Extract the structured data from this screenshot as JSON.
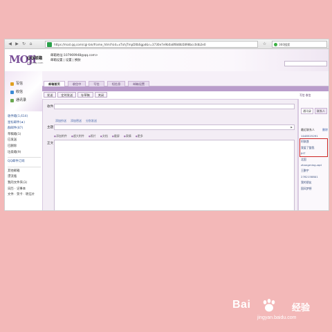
{
  "browser": {
    "url": "https://mail.qq.com/cgi-bin/frame_html?sid=xTxhjTmpD0bSgpd&r=3730e7e9b0a8f8d8b5898bcc0db2e0",
    "search_placeholder": "360搜索"
  },
  "header": {
    "logo_text": "MOJi",
    "brand": "QQ邮箱",
    "domain": "mail.qq.com",
    "account_line1": "邮箱地址:107969948@qq.com>",
    "account_line2": "邮箱设置 | 设置 | 换肤"
  },
  "tabs": [
    "邮箱首页",
    "收信中",
    "写信",
    "短信息",
    "邮箱设置"
  ],
  "left_actions": [
    {
      "label": "写信",
      "color": "#e0a020"
    },
    {
      "label": "收信",
      "color": "#3a8ad6"
    },
    {
      "label": "通讯录",
      "color": "#6aa84f"
    }
  ],
  "folders": [
    {
      "label": "收件箱(1,614)",
      "link": true
    },
    {
      "label": "星标邮件(★)",
      "link": true
    },
    {
      "label": "群邮件(87)",
      "link": true
    },
    {
      "label": "草稿箱(1)",
      "link": false
    },
    {
      "label": "已发送",
      "link": false
    },
    {
      "label": "已删除",
      "link": false
    },
    {
      "label": "垃圾箱(9)",
      "link": false
    },
    {
      "label": "QQ邮件订阅",
      "link": true
    },
    {
      "label": "其他邮箱",
      "link": false
    },
    {
      "label": "漂流瓶",
      "link": false
    },
    {
      "label": "我的文件夹(3)",
      "link": false
    },
    {
      "label": "日历 · 记事本",
      "link": false
    },
    {
      "label": "文件 · 贺卡 · 明信片",
      "link": false
    }
  ],
  "toolbar": [
    "发送",
    "定时发送",
    "存草稿",
    "关闭"
  ],
  "compose": {
    "to_label": "收件人",
    "subject_label": "主题",
    "body_label": "正文",
    "mini_links": [
      "添加抄送",
      "添加密送",
      "分别发送"
    ],
    "format_items": [
      "添加附件",
      "超大附件",
      "照片",
      "文档",
      "截屏",
      "表情",
      "更多"
    ]
  },
  "right_panel": {
    "tabs": [
      "通讯录",
      "联系人"
    ],
    "edit_label": "最近联系人",
    "edit_link": "删除",
    "contacts": [
      "1048525291",
      "阿联酋",
      "我爱了整我",
      "JHT",
      "北国",
      "zhangming.zqd",
      "王鹏宇",
      "2782158801",
      "我的朋友",
      "国风梦想"
    ],
    "header_label": "写信  收信"
  },
  "watermark": {
    "bai": "Bai",
    "jingyan": "经验",
    "url": "jingyan.baidu.com"
  }
}
